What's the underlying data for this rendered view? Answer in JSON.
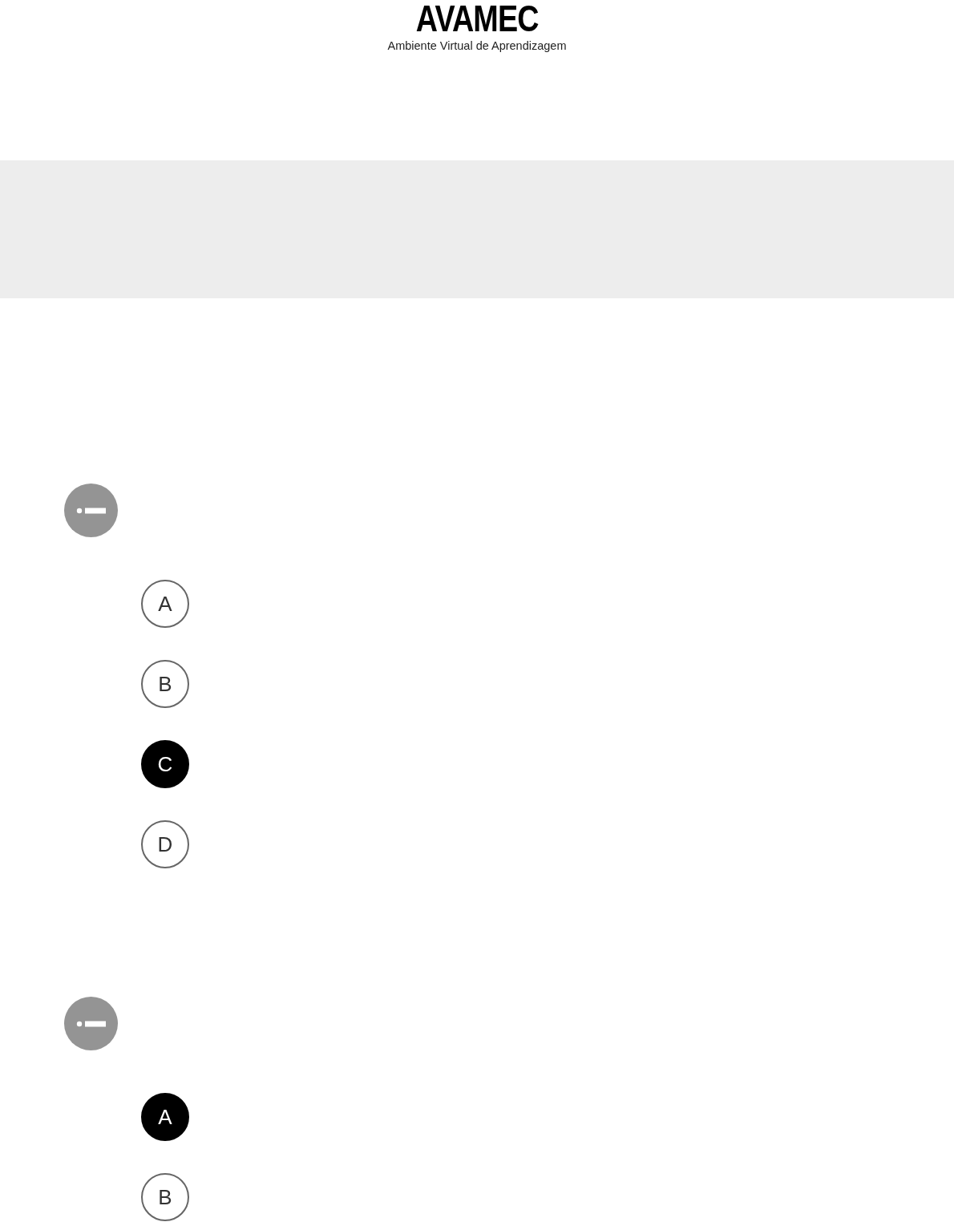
{
  "header": {
    "logo": "AVAMEC",
    "subtitle": "Ambiente Virtual de Aprendizagem"
  },
  "questions": [
    {
      "options": [
        {
          "letter": "A",
          "selected": false
        },
        {
          "letter": "B",
          "selected": false
        },
        {
          "letter": "C",
          "selected": true
        },
        {
          "letter": "D",
          "selected": false
        }
      ]
    },
    {
      "options": [
        {
          "letter": "A",
          "selected": true
        },
        {
          "letter": "B",
          "selected": false
        }
      ]
    }
  ]
}
